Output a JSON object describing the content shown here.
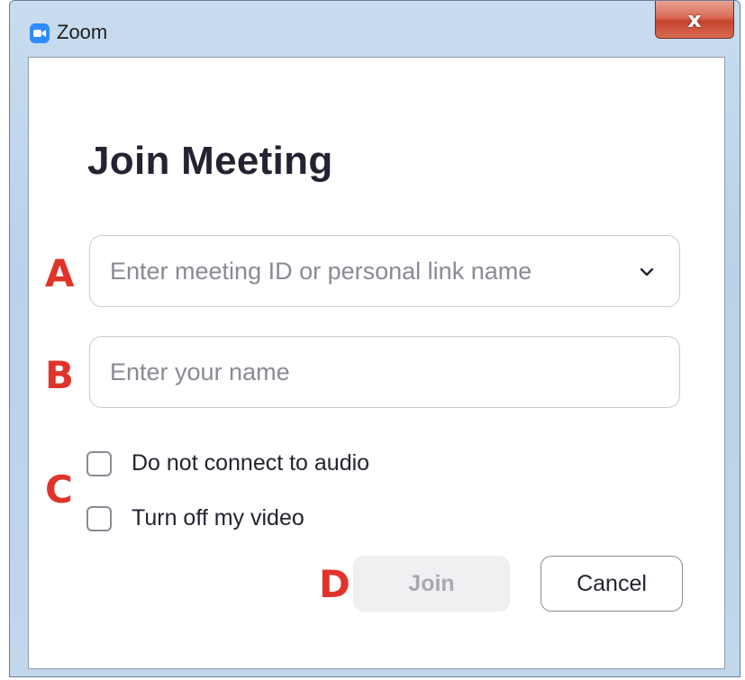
{
  "window": {
    "title": "Zoom",
    "close_glyph": "x",
    "app_icon": "zoom-camera-icon",
    "close_icon": "close-icon"
  },
  "dialog": {
    "heading": "Join Meeting",
    "meeting_id": {
      "value": "",
      "placeholder": "Enter meeting ID or personal link name",
      "dropdown_icon": "chevron-down-icon"
    },
    "name": {
      "value": "",
      "placeholder": "Enter your name"
    },
    "options": [
      {
        "label": "Do not connect to audio",
        "checked": false
      },
      {
        "label": "Turn off my video",
        "checked": false
      }
    ],
    "buttons": {
      "join": "Join",
      "join_enabled": false,
      "cancel": "Cancel"
    }
  },
  "annotations": {
    "a": "A",
    "b": "B",
    "c": "C",
    "d": "D",
    "color": "#e0342b"
  },
  "colors": {
    "accent": "#2d8cff",
    "heading_text": "#232333",
    "placeholder_text": "#8a8a96",
    "disabled_button_bg": "#f0f0f3"
  }
}
